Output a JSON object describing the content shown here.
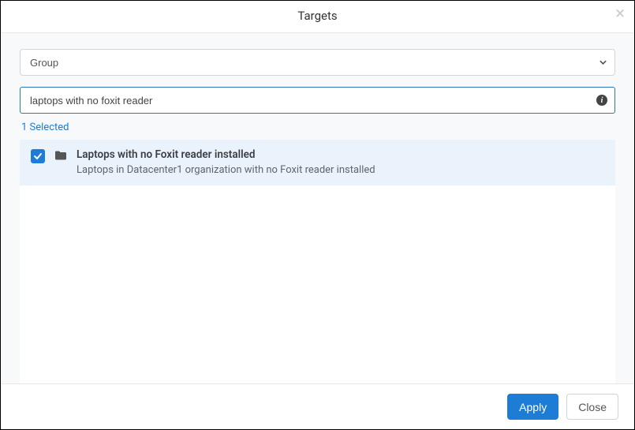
{
  "header": {
    "title": "Targets"
  },
  "filter": {
    "group_label": "Group",
    "search_value": "laptops with no foxit reader"
  },
  "status": {
    "selected_text": "1 Selected"
  },
  "results": [
    {
      "checked": true,
      "title": "Laptops with no Foxit reader installed",
      "desc": "Laptops in Datacenter1 organization with no Foxit reader installed"
    }
  ],
  "footer": {
    "apply": "Apply",
    "close": "Close"
  }
}
